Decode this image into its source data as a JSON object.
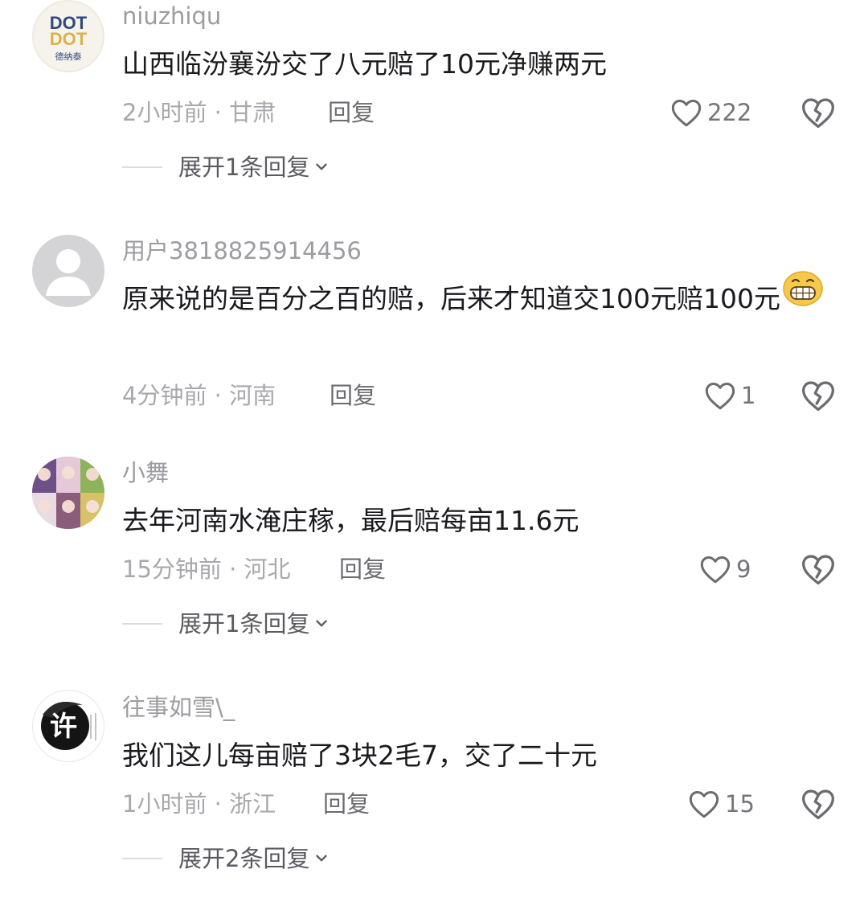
{
  "comments": [
    {
      "username": "niuzhiqu",
      "avatar_logo_text": "DOT DOT 德纳泰",
      "text": "山西临汾襄汾交了八元赔了10元净赚两元",
      "meta": "2小时前 · 甘肃",
      "reply_label": "回复",
      "likes": "222",
      "expand_label": "展开1条回复"
    },
    {
      "username": "用户3818825914456",
      "text": "原来说的是百分之百的赔，后来才知道交100元赔100元",
      "meta": "4分钟前 · 河南",
      "reply_label": "回复",
      "likes": "1"
    },
    {
      "username": "小舞",
      "text": "去年河南水淹庄稼，最后赔每亩11.6元",
      "meta": "15分钟前 · 河北",
      "reply_label": "回复",
      "likes": "9",
      "expand_label": "展开1条回复"
    },
    {
      "username": "往事如雪\\_",
      "avatar_glyph": "许",
      "text": "我们这儿每亩赔了3块2毛7，交了二十元",
      "meta": "1小时前 · 浙江",
      "reply_label": "回复",
      "likes": "15",
      "expand_label": "展开2条回复"
    }
  ],
  "icons": {
    "like": "heart-outline-icon",
    "dislike": "broken-heart-icon",
    "expand": "chevron-down-icon",
    "emoji": "grinning-face-emoji"
  }
}
